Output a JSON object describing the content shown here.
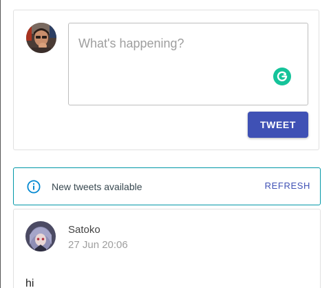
{
  "compose": {
    "placeholder": "What's happening?",
    "tweet_button_label": "TWEET",
    "avatar_icon": "user-avatar-photo",
    "grammarly_icon": "grammarly-icon"
  },
  "banner": {
    "message": "New tweets available",
    "refresh_label": "REFRESH",
    "icon": "info-icon"
  },
  "tweets": [
    {
      "author": "Satoko",
      "timestamp": "27 Jun 20:06",
      "text": "hi",
      "avatar_icon": "user-avatar-photo"
    }
  ],
  "colors": {
    "accent": "#3f51b5",
    "banner_border": "#0097a7",
    "grammarly": "#15c39a"
  }
}
